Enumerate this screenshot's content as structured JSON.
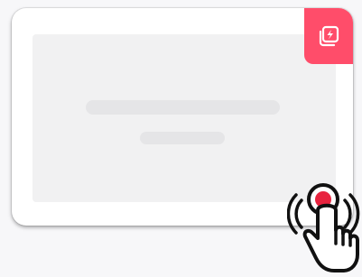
{
  "colors": {
    "accent": "#ff4d6a",
    "background": "#f7f7f9",
    "card": "#ffffff",
    "placeholder": "#f1f1f2",
    "skeleton": "#e5e5e7",
    "tap_dot": "#e8243f"
  },
  "icons": {
    "badge": "flash-stack-icon",
    "cursor": "tap-hand-icon"
  }
}
